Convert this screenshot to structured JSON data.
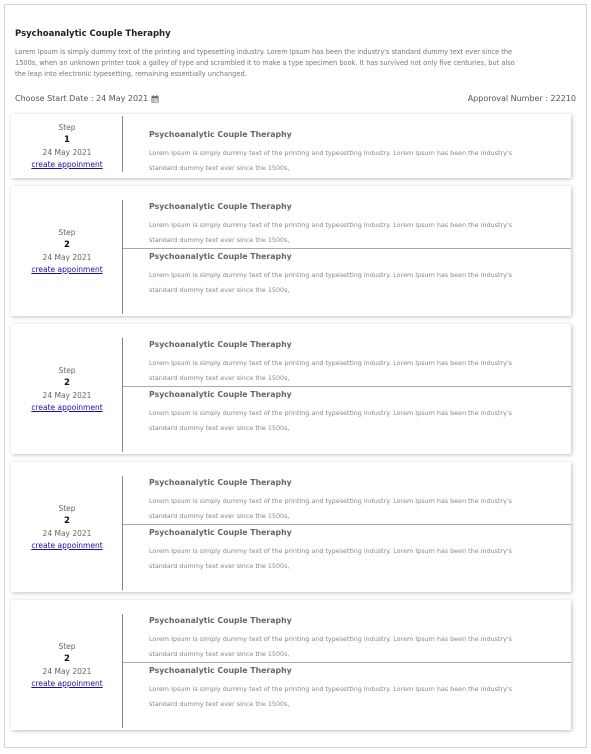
{
  "header": {
    "title": "Psychoanalytic Couple Theraphy",
    "description": "Lorem Ipsum is simply dummy text of the printing and typesetting industry. Lorem Ipsum has been the industry's standard dummy text ever since the 1500s, when an unknown printer took a galley of type and scrambled it to make a type specimen book. It has survived not only five centuries, but also the leap into electronic typesetting, remaining essentially unchanged."
  },
  "meta": {
    "start_date": "Choose Start Date : 24 May 2021",
    "calendar_icon": "calendar-icon",
    "approval": "Apporoval Number : 22210"
  },
  "cards": [
    {
      "step_label": "Step",
      "step_number": "1",
      "date": "24 May 2021",
      "link": "create appoinment",
      "sessions": [
        {
          "title": "Psychoanalytic Couple Theraphy",
          "desc": "Lorem Ipsum is simply dummy text of the printing and typesetting industry. Lorem Ipsum has been the industry's standard dummy text ever since the 1500s,"
        }
      ]
    },
    {
      "step_label": "Step",
      "step_number": "2",
      "date": "24 May 2021",
      "link": "create appoinment",
      "sessions": [
        {
          "title": "Psychoanalytic Couple Theraphy",
          "desc": "Lorem Ipsum is simply dummy text of the printing and typesetting industry. Lorem Ipsum has been the industry's standard dummy text ever since the 1500s,"
        },
        {
          "title": "Psychoanalytic Couple Theraphy",
          "desc": "Lorem Ipsum is simply dummy text of the printing and typesetting industry. Lorem Ipsum has been the industry's standard dummy text ever since the 1500s,"
        }
      ]
    },
    {
      "step_label": "Step",
      "step_number": "2",
      "date": "24 May 2021",
      "link": "create appoinment",
      "sessions": [
        {
          "title": "Psychoanalytic Couple Theraphy",
          "desc": "Lorem Ipsum is simply dummy text of the printing and typesetting industry. Lorem Ipsum has been the industry's standard dummy text ever since the 1500s,"
        },
        {
          "title": "Psychoanalytic Couple Theraphy",
          "desc": "Lorem Ipsum is simply dummy text of the printing and typesetting industry. Lorem Ipsum has been the industry's standard dummy text ever since the 1500s,"
        }
      ]
    },
    {
      "step_label": "Step",
      "step_number": "2",
      "date": "24 May 2021",
      "link": "create appoinment",
      "sessions": [
        {
          "title": "Psychoanalytic Couple Theraphy",
          "desc": "Lorem Ipsum is simply dummy text of the printing and typesetting industry. Lorem Ipsum has been the industry's standard dummy text ever since the 1500s,"
        },
        {
          "title": "Psychoanalytic Couple Theraphy",
          "desc": "Lorem Ipsum is simply dummy text of the printing and typesetting industry. Lorem Ipsum has been the industry's standard dummy text ever since the 1500s,"
        }
      ]
    },
    {
      "step_label": "Step",
      "step_number": "2",
      "date": "24 May 2021",
      "link": "create appoinment",
      "sessions": [
        {
          "title": "Psychoanalytic Couple Theraphy",
          "desc": "Lorem Ipsum is simply dummy text of the printing and typesetting industry. Lorem Ipsum has been the industry's standard dummy text ever since the 1500s,"
        },
        {
          "title": "Psychoanalytic Couple Theraphy",
          "desc": "Lorem Ipsum is simply dummy text of the printing and typesetting industry. Lorem Ipsum has been the industry's standard dummy text ever since the 1500s,"
        }
      ]
    }
  ]
}
